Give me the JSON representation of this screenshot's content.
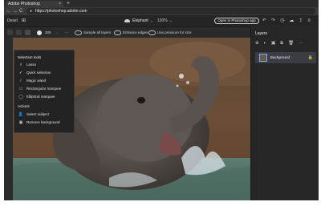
{
  "browser": {
    "tab_title": "Adobe Photoshop",
    "tab_close": "×",
    "new_tab": "+",
    "back": "←",
    "forward": "→",
    "reload": "C",
    "url": "https://photoshop.adobe.com"
  },
  "app_header": {
    "left_label": "Desel",
    "doc_name": "Elephant",
    "zoom": "100%",
    "open_button": "Open in Photoshop app",
    "icons": [
      "undo-icon",
      "redo-icon",
      "history-icon",
      "cloud-icon",
      "share-icon",
      "menu-icon"
    ]
  },
  "options_bar": {
    "brush_size": "305",
    "more": "···",
    "sample_all_layers": "Sample all layers",
    "enhance_edges": "Enhance edges",
    "use_pressure": "Use pressure for size"
  },
  "flyout": {
    "section1": "Selection tools",
    "items": [
      {
        "label": "Lasso",
        "icon": "lasso-icon",
        "glyph": "ℓ"
      },
      {
        "label": "Quick selection",
        "icon": "quick-selection-icon",
        "glyph": "✓"
      },
      {
        "label": "Magic wand",
        "icon": "magic-wand-icon",
        "glyph": "⁄"
      },
      {
        "label": "Rectangular marquee",
        "icon": "rect-marquee-icon",
        "glyph": "▭"
      },
      {
        "label": "Elliptical marquee",
        "icon": "ellipse-marquee-icon",
        "glyph": "◯"
      }
    ],
    "section2": "Actions",
    "actions": [
      {
        "label": "Select subject",
        "icon": "select-subject-icon",
        "glyph": "👤"
      },
      {
        "label": "Remove background",
        "icon": "remove-background-icon",
        "glyph": "▣"
      }
    ]
  },
  "layers_panel": {
    "title": "Layers",
    "layer_name": "Background",
    "lock": "🔒"
  },
  "colors": {
    "accent": "#7aa7ff",
    "panel_bg": "#262626",
    "app_bg": "#1e1e1e"
  }
}
